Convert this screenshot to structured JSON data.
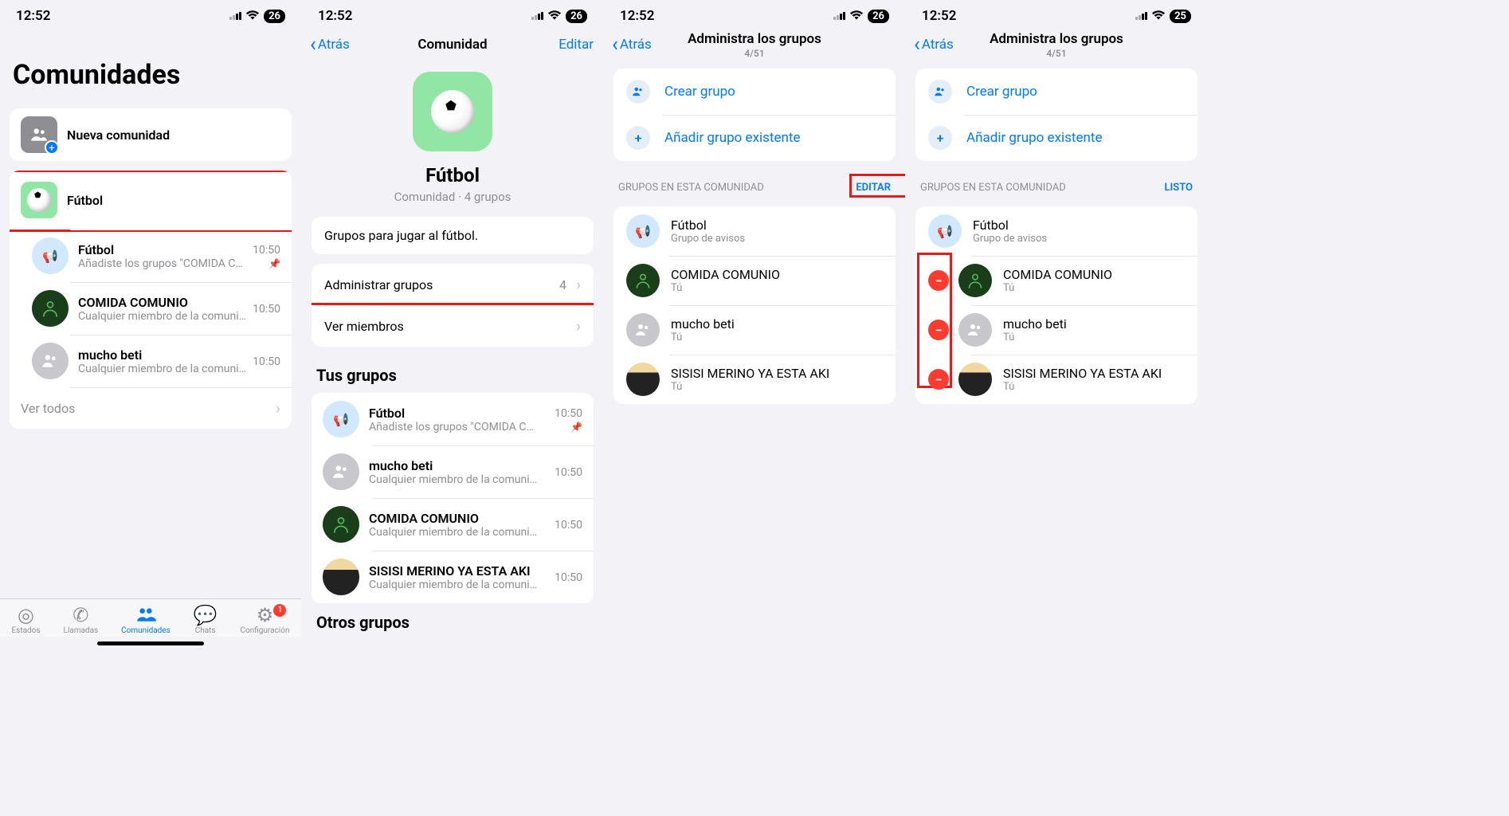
{
  "status": {
    "time": "12:52",
    "battery_a": "26",
    "battery_d": "25"
  },
  "s1": {
    "title": "Comunidades",
    "new_community": "Nueva comunidad",
    "community_name": "Fútbol",
    "chats": [
      {
        "title": "Fútbol",
        "subtitle": "Añadiste los grupos \"COMIDA C…",
        "time": "10:50",
        "pinned": true,
        "icon": "megaphone"
      },
      {
        "title": "COMIDA COMUNIO",
        "subtitle": "Cualquier miembro de la comuni…",
        "time": "10:50",
        "icon": "darkgreen"
      },
      {
        "title": "mucho beti",
        "subtitle": "Cualquier miembro de la comuni…",
        "time": "10:50",
        "icon": "gray"
      }
    ],
    "see_all": "Ver todos",
    "tabs": {
      "status": "Estados",
      "calls": "Llamadas",
      "communities": "Comunidades",
      "chats": "Chats",
      "settings": "Configuración",
      "badge": "1"
    }
  },
  "s2": {
    "back": "Atrás",
    "title": "Comunidad",
    "edit": "Editar",
    "name": "Fútbol",
    "sub": "Comunidad · 4 grupos",
    "description": "Grupos para jugar al fútbol.",
    "manage_groups": "Administrar grupos",
    "manage_count": "4",
    "view_members": "Ver miembros",
    "your_groups": "Tus grupos",
    "groups": [
      {
        "title": "Fútbol",
        "subtitle": "Añadiste los grupos \"COMIDA C…",
        "time": "10:50",
        "pinned": true,
        "icon": "megaphone"
      },
      {
        "title": "mucho beti",
        "subtitle": "Cualquier miembro de la comuni…",
        "time": "10:50",
        "icon": "gray"
      },
      {
        "title": "COMIDA COMUNIO",
        "subtitle": "Cualquier miembro de la comuni…",
        "time": "10:50",
        "icon": "darkgreen"
      },
      {
        "title": "SISISI MERINO YA ESTA AKI",
        "subtitle": "Cualquier miembro de la comuni…",
        "time": "10:50",
        "icon": "photo"
      }
    ],
    "other_groups": "Otros grupos"
  },
  "s3": {
    "back": "Atrás",
    "title": "Administra los grupos",
    "count": "4/51",
    "create_group": "Crear grupo",
    "add_existing": "Añadir grupo existente",
    "section": "GRUPOS EN ESTA COMUNIDAD",
    "edit": "EDITAR",
    "done": "LISTO",
    "groups": [
      {
        "title": "Fútbol",
        "sub": "Grupo de avisos",
        "icon": "megaphone"
      },
      {
        "title": "COMIDA COMUNIO",
        "sub": "Tú",
        "icon": "darkgreen"
      },
      {
        "title": "mucho beti",
        "sub": "Tú",
        "icon": "gray"
      },
      {
        "title": "SISISI MERINO YA ESTA AKI",
        "sub": "Tú",
        "icon": "photo"
      }
    ]
  }
}
